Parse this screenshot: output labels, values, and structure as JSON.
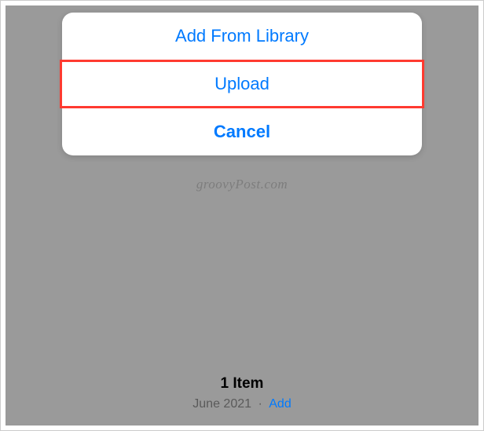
{
  "actionSheet": {
    "options": {
      "addFromLibrary": "Add From Library",
      "upload": "Upload",
      "cancel": "Cancel"
    }
  },
  "watermark": "groovyPost.com",
  "footer": {
    "itemCount": "1 Item",
    "date": "June 2021",
    "separator": "·",
    "addLabel": "Add"
  }
}
